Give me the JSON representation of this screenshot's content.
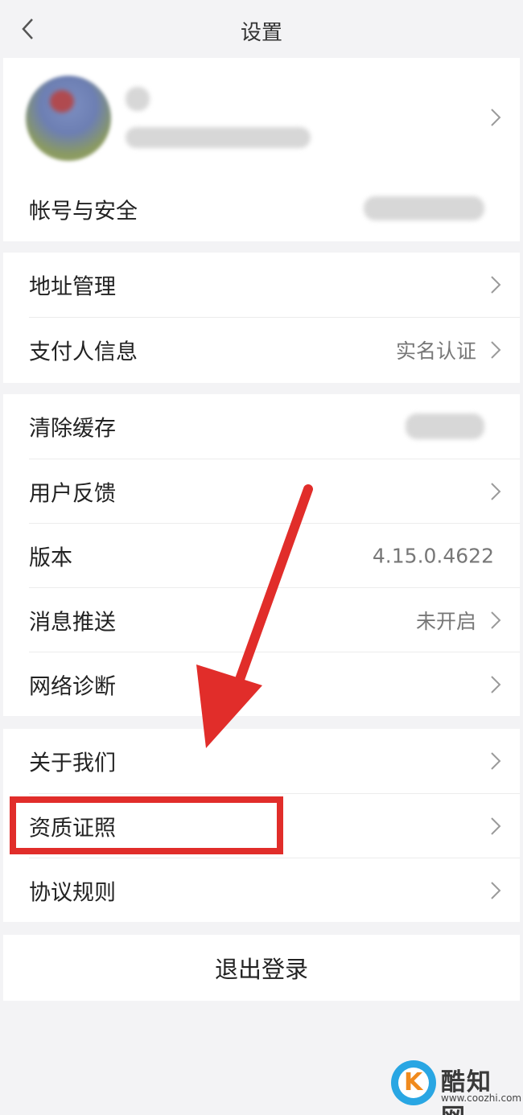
{
  "navbar": {
    "title": "设置",
    "back_icon": "chevron-left-icon"
  },
  "profile": {
    "blurred": true
  },
  "account": {
    "label": "帐号与安全"
  },
  "address": {
    "label": "地址管理"
  },
  "payer": {
    "label": "支付人信息",
    "value": "实名认证"
  },
  "cache": {
    "label": "清除缓存"
  },
  "feedback": {
    "label": "用户反馈"
  },
  "version": {
    "label": "版本",
    "value": "4.15.0.4622"
  },
  "push": {
    "label": "消息推送",
    "value": "未开启"
  },
  "network": {
    "label": "网络诊断"
  },
  "about": {
    "label": "关于我们"
  },
  "license": {
    "label": "资质证照"
  },
  "agreement": {
    "label": "协议规则"
  },
  "logout": {
    "label": "退出登录"
  },
  "annotation": {
    "color": "#e12d2a"
  },
  "watermark": {
    "name": "酷知网",
    "url": "www.coozhi.com",
    "logo_letter": "K"
  }
}
